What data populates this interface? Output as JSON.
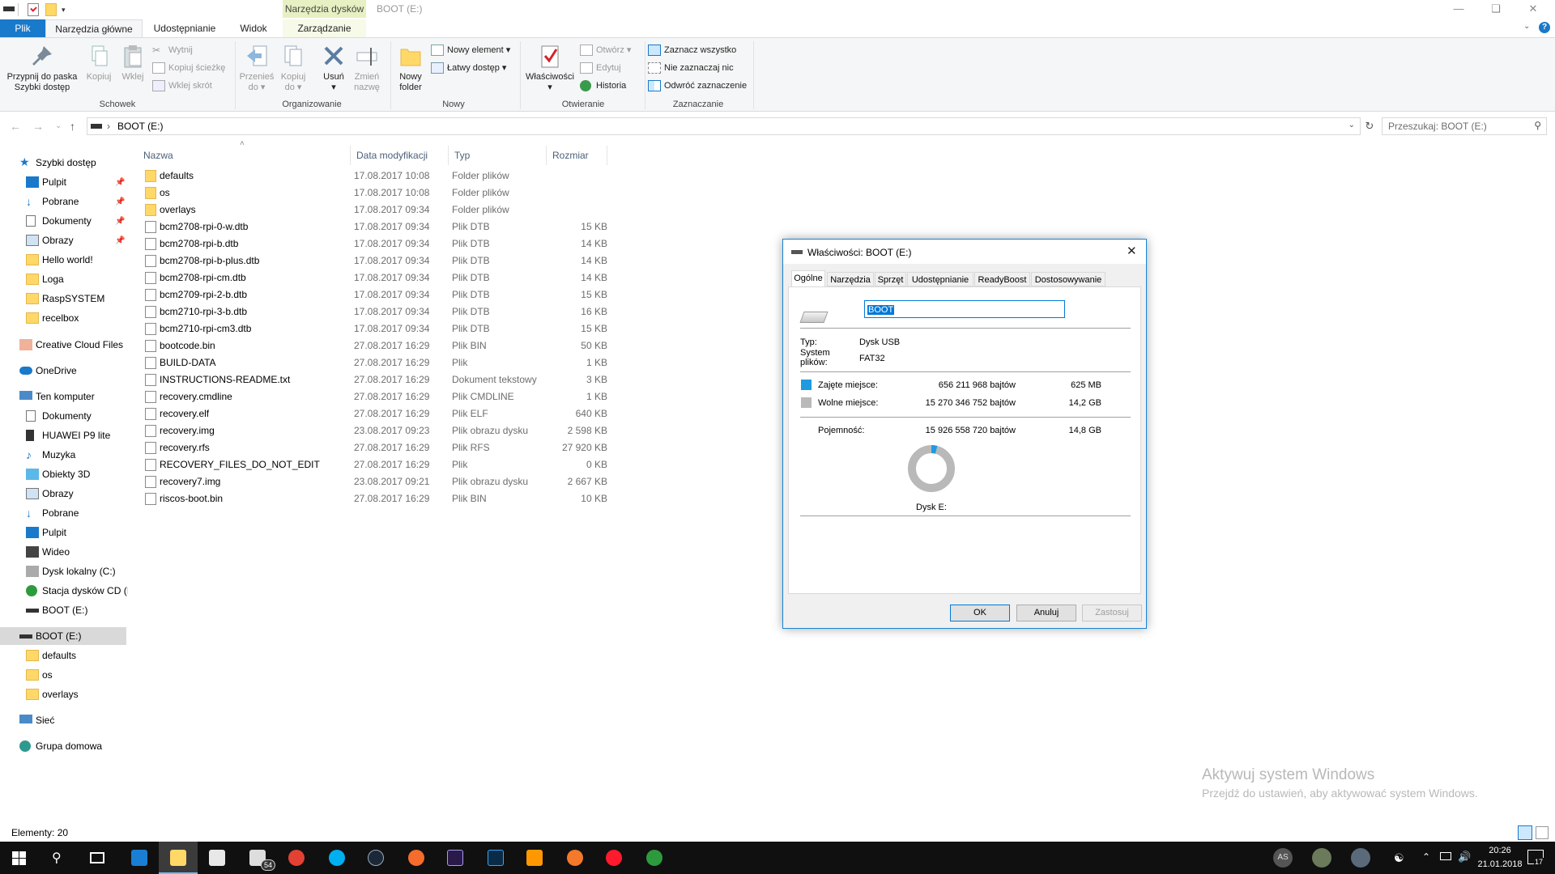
{
  "window": {
    "title": "BOOT (E:)",
    "context_tab_header": "Narzędzia dysków"
  },
  "tabs": [
    {
      "label": "Plik"
    },
    {
      "label": "Narzędzia główne"
    },
    {
      "label": "Udostępnianie"
    },
    {
      "label": "Widok"
    },
    {
      "label": "Zarządzanie"
    }
  ],
  "ribbon": {
    "schowek": {
      "label": "Schowek",
      "pin_line1": "Przypnij do paska",
      "pin_line2": "Szybki dostęp",
      "copy": "Kopiuj",
      "paste": "Wklej",
      "cut": "Wytnij",
      "copy_path": "Kopiuj ścieżkę",
      "paste_shortcut": "Wklej skrót"
    },
    "organizowanie": {
      "label": "Organizowanie",
      "move_line1": "Przenieś",
      "move_line2": "do",
      "copyto_line1": "Kopiuj",
      "copyto_line2": "do",
      "delete": "Usuń",
      "rename_line1": "Zmień",
      "rename_line2": "nazwę"
    },
    "nowy": {
      "label": "Nowy",
      "folder_line1": "Nowy",
      "folder_line2": "folder",
      "new_item": "Nowy element",
      "easy_access": "Łatwy dostęp"
    },
    "otwieranie": {
      "label": "Otwieranie",
      "properties": "Właściwości",
      "open": "Otwórz",
      "edit": "Edytuj",
      "history": "Historia"
    },
    "zaznaczanie": {
      "label": "Zaznaczanie",
      "select_all": "Zaznacz wszystko",
      "select_none": "Nie zaznaczaj nic",
      "invert": "Odwróć zaznaczenie"
    }
  },
  "address": {
    "path": "BOOT (E:)",
    "search_placeholder": "Przeszukaj: BOOT (E:)"
  },
  "nav": {
    "quick_access": "Szybki dostęp",
    "quick_items": [
      "Pulpit",
      "Pobrane",
      "Dokumenty",
      "Obrazy",
      "Hello world!",
      "Loga",
      "RaspSYSTEM",
      "recelbox"
    ],
    "creative_cloud": "Creative Cloud Files",
    "onedrive": "OneDrive",
    "this_pc": "Ten komputer",
    "pc_items": [
      "Dokumenty",
      "HUAWEI P9 lite",
      "Muzyka",
      "Obiekty 3D",
      "Obrazy",
      "Pobrane",
      "Pulpit",
      "Wideo",
      "Dysk lokalny (C:)",
      "Stacja dysków CD (I",
      "BOOT (E:)"
    ],
    "boot_drive": "BOOT (E:)",
    "boot_items": [
      "defaults",
      "os",
      "overlays"
    ],
    "network": "Sieć",
    "homegroup": "Grupa domowa"
  },
  "columns": {
    "name": "Nazwa",
    "date": "Data modyfikacji",
    "type": "Typ",
    "size": "Rozmiar"
  },
  "files": [
    {
      "name": "defaults",
      "date": "17.08.2017 10:08",
      "type": "Folder plików",
      "size": "",
      "kind": "folder"
    },
    {
      "name": "os",
      "date": "17.08.2017 10:08",
      "type": "Folder plików",
      "size": "",
      "kind": "folder"
    },
    {
      "name": "overlays",
      "date": "17.08.2017 09:34",
      "type": "Folder plików",
      "size": "",
      "kind": "folder"
    },
    {
      "name": "bcm2708-rpi-0-w.dtb",
      "date": "17.08.2017 09:34",
      "type": "Plik DTB",
      "size": "15 KB",
      "kind": "file"
    },
    {
      "name": "bcm2708-rpi-b.dtb",
      "date": "17.08.2017 09:34",
      "type": "Plik DTB",
      "size": "14 KB",
      "kind": "file"
    },
    {
      "name": "bcm2708-rpi-b-plus.dtb",
      "date": "17.08.2017 09:34",
      "type": "Plik DTB",
      "size": "14 KB",
      "kind": "file"
    },
    {
      "name": "bcm2708-rpi-cm.dtb",
      "date": "17.08.2017 09:34",
      "type": "Plik DTB",
      "size": "14 KB",
      "kind": "file"
    },
    {
      "name": "bcm2709-rpi-2-b.dtb",
      "date": "17.08.2017 09:34",
      "type": "Plik DTB",
      "size": "15 KB",
      "kind": "file"
    },
    {
      "name": "bcm2710-rpi-3-b.dtb",
      "date": "17.08.2017 09:34",
      "type": "Plik DTB",
      "size": "16 KB",
      "kind": "file"
    },
    {
      "name": "bcm2710-rpi-cm3.dtb",
      "date": "17.08.2017 09:34",
      "type": "Plik DTB",
      "size": "15 KB",
      "kind": "file"
    },
    {
      "name": "bootcode.bin",
      "date": "27.08.2017 16:29",
      "type": "Plik BIN",
      "size": "50 KB",
      "kind": "file"
    },
    {
      "name": "BUILD-DATA",
      "date": "27.08.2017 16:29",
      "type": "Plik",
      "size": "1 KB",
      "kind": "file"
    },
    {
      "name": "INSTRUCTIONS-README.txt",
      "date": "27.08.2017 16:29",
      "type": "Dokument tekstowy",
      "size": "3 KB",
      "kind": "file"
    },
    {
      "name": "recovery.cmdline",
      "date": "27.08.2017 16:29",
      "type": "Plik CMDLINE",
      "size": "1 KB",
      "kind": "file"
    },
    {
      "name": "recovery.elf",
      "date": "27.08.2017 16:29",
      "type": "Plik ELF",
      "size": "640 KB",
      "kind": "file"
    },
    {
      "name": "recovery.img",
      "date": "23.08.2017 09:23",
      "type": "Plik obrazu dysku",
      "size": "2 598 KB",
      "kind": "file"
    },
    {
      "name": "recovery.rfs",
      "date": "27.08.2017 16:29",
      "type": "Plik RFS",
      "size": "27 920 KB",
      "kind": "file"
    },
    {
      "name": "RECOVERY_FILES_DO_NOT_EDIT",
      "date": "27.08.2017 16:29",
      "type": "Plik",
      "size": "0 KB",
      "kind": "file"
    },
    {
      "name": "recovery7.img",
      "date": "23.08.2017 09:21",
      "type": "Plik obrazu dysku",
      "size": "2 667 KB",
      "kind": "file"
    },
    {
      "name": "riscos-boot.bin",
      "date": "27.08.2017 16:29",
      "type": "Plik BIN",
      "size": "10 KB",
      "kind": "file"
    }
  ],
  "status": {
    "items_count": "Elementy: 20"
  },
  "dialog": {
    "title": "Właściwości: BOOT (E:)",
    "tabs": [
      "Ogólne",
      "Narzędzia",
      "Sprzęt",
      "Udostępnianie",
      "ReadyBoost",
      "Dostosowywanie"
    ],
    "label_value": "BOOT",
    "type_label": "Typ:",
    "type_value": "Dysk USB",
    "fs_label_line1": "System",
    "fs_label_line2": "plików:",
    "fs_value": "FAT32",
    "used_label": "Zajęte miejsce:",
    "used_bytes": "656 211 968 bajtów",
    "used_hr": "625 MB",
    "free_label": "Wolne miejsce:",
    "free_bytes": "15 270 346 752 bajtów",
    "free_hr": "14,2 GB",
    "capacity_label": "Pojemność:",
    "capacity_bytes": "15 926 558 720 bajtów",
    "capacity_hr": "14,8 GB",
    "drive_caption": "Dysk E:",
    "used_fraction": 0.0412,
    "used_color": "#1f9ae0",
    "free_color": "#b9b9b9",
    "ok": "OK",
    "cancel": "Anuluj",
    "apply": "Zastosuj"
  },
  "watermark": {
    "line1": "Aktywuj system Windows",
    "line2": "Przejdź do ustawień, aby aktywować system Windows."
  },
  "taskbar": {
    "mail_badge": "54",
    "user_initials": "AS",
    "time": "20:26",
    "date": "21.01.2018",
    "notif_count": "17"
  },
  "colors": {
    "accent": "#1979ca",
    "selection": "#cce8ff"
  }
}
